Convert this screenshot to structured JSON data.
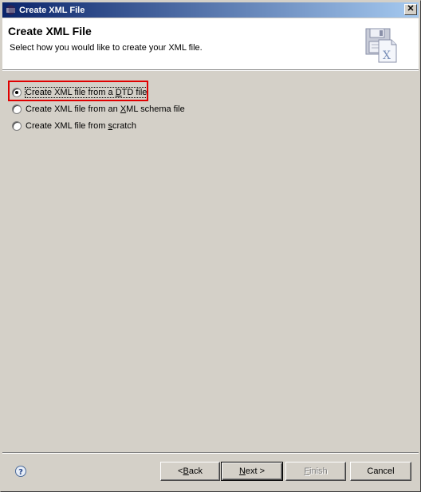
{
  "window": {
    "title": "Create XML File"
  },
  "banner": {
    "title": "Create XML File",
    "description": "Select how you would like to create your XML file.",
    "icon": "xml-file-wizard-icon"
  },
  "options": [
    {
      "pre": "Create XML file from a ",
      "mnemonic": "D",
      "post": "TD file",
      "selected": true,
      "highlighted": true
    },
    {
      "pre": "Create XML file from an ",
      "mnemonic": "X",
      "post": "ML schema file",
      "selected": false,
      "highlighted": false
    },
    {
      "pre": "Create XML file from ",
      "mnemonic": "s",
      "post": "cratch",
      "selected": false,
      "highlighted": false
    }
  ],
  "buttons": {
    "back": {
      "pre": "< ",
      "mnemonic": "B",
      "post": "ack"
    },
    "next": {
      "pre": "",
      "mnemonic": "N",
      "post": "ext >"
    },
    "finish": {
      "pre": "",
      "mnemonic": "F",
      "post": "inish",
      "disabled": true
    },
    "cancel": {
      "pre": "Cancel",
      "mnemonic": "",
      "post": ""
    }
  },
  "help": {
    "glyph": "?"
  },
  "colors": {
    "titlebar_start": "#0a246a",
    "titlebar_end": "#a6caf0",
    "highlight_box": "#e00000",
    "dialog_bg": "#d4d0c8"
  }
}
